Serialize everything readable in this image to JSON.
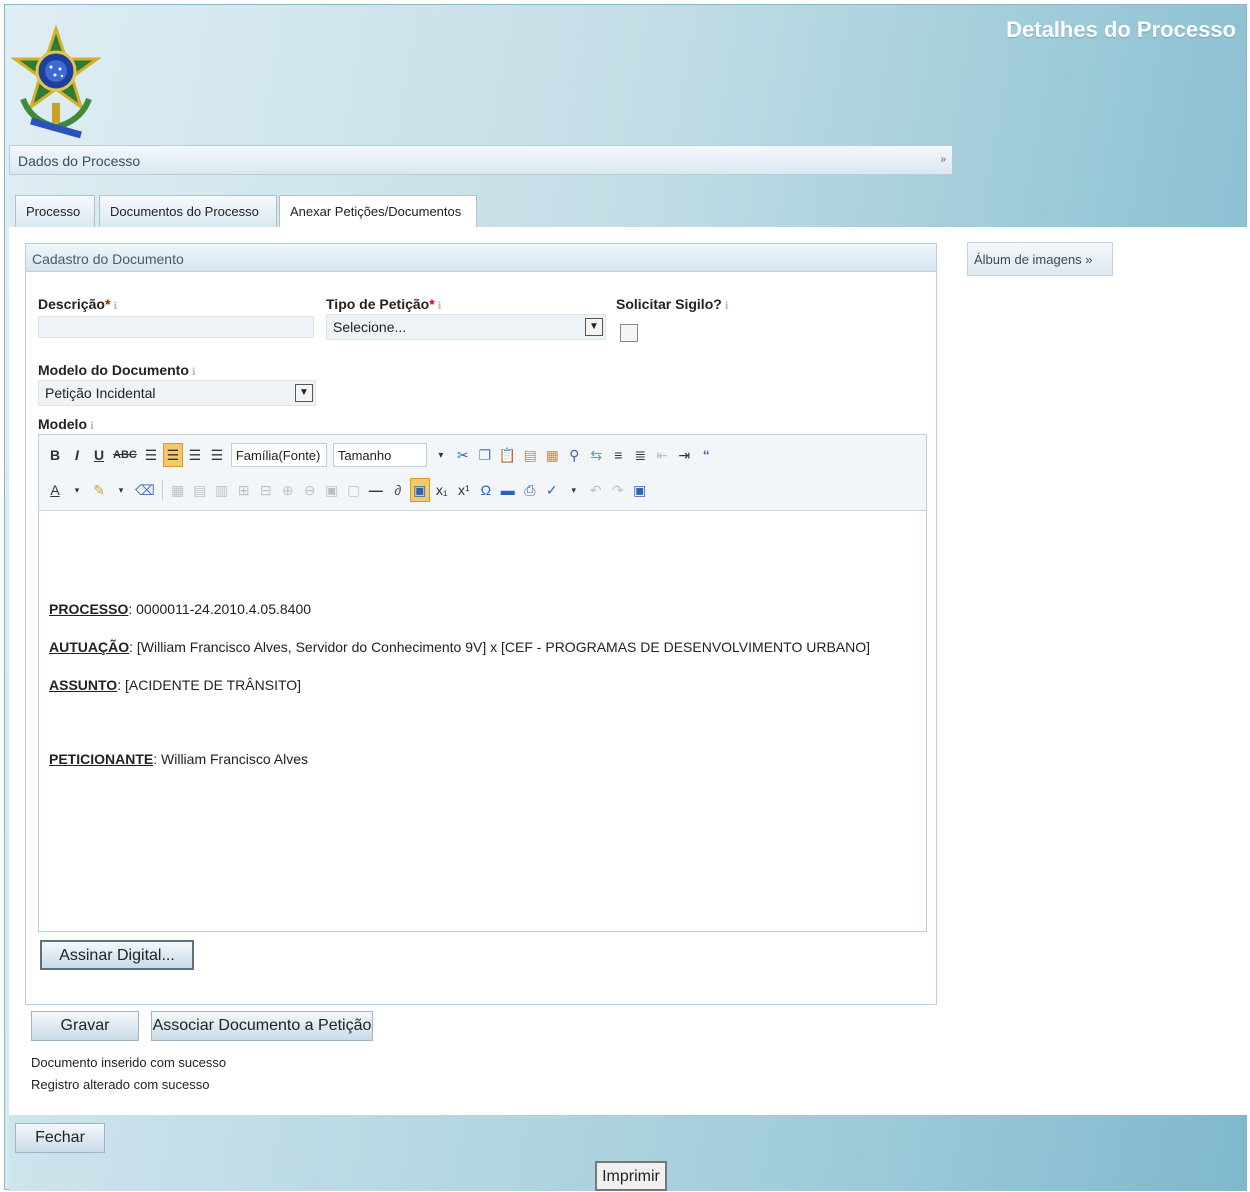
{
  "header": {
    "title": "Detalhes do Processo"
  },
  "section": {
    "label": "Dados do Processo",
    "toggle": "»"
  },
  "tabs": [
    {
      "label": "Processo"
    },
    {
      "label": "Documentos do Processo"
    },
    {
      "label": "Anexar Petições/Documentos"
    }
  ],
  "panel": {
    "title": "Cadastro do Documento"
  },
  "form": {
    "descricao_label": "Descrição",
    "tipo_label": "Tipo de Petição",
    "tipo_value": "Selecione...",
    "sigilo_label": "Solicitar Sigilo?",
    "modelo_doc_label": "Modelo do Documento",
    "modelo_doc_value": "Petição Incidental",
    "modelo_label": "Modelo",
    "required_mark": "*"
  },
  "toolbar": {
    "font_family": "Família(Fonte)",
    "font_size": "Tamanho"
  },
  "document": {
    "processo_key": "PROCESSO",
    "processo_val": ": 0000011-24.2010.4.05.8400",
    "autuacao_key": "AUTUAÇÃO",
    "autuacao_val": ": [William Francisco Alves, Servidor do Conhecimento 9V] x [CEF - PROGRAMAS DE DESENVOLVIMENTO URBANO]",
    "assunto_key": "ASSUNTO",
    "assunto_val": ": [ACIDENTE DE TRÂNSITO]",
    "peticionante_key": "PETICIONANTE",
    "peticionante_val": ": William Francisco Alves"
  },
  "buttons": {
    "assinar": "Assinar Digital...",
    "gravar": "Gravar",
    "associar": "Associar Documento a Petição",
    "fechar": "Fechar",
    "imprimir": "Imprimir"
  },
  "album": {
    "label": "Álbum de imagens »"
  },
  "messages": [
    "Documento inserido com sucesso",
    "Registro alterado com sucesso"
  ],
  "colors": {
    "accent": "#7fb8cd",
    "required": "#dd0000",
    "highlight": "#f5c86a"
  }
}
